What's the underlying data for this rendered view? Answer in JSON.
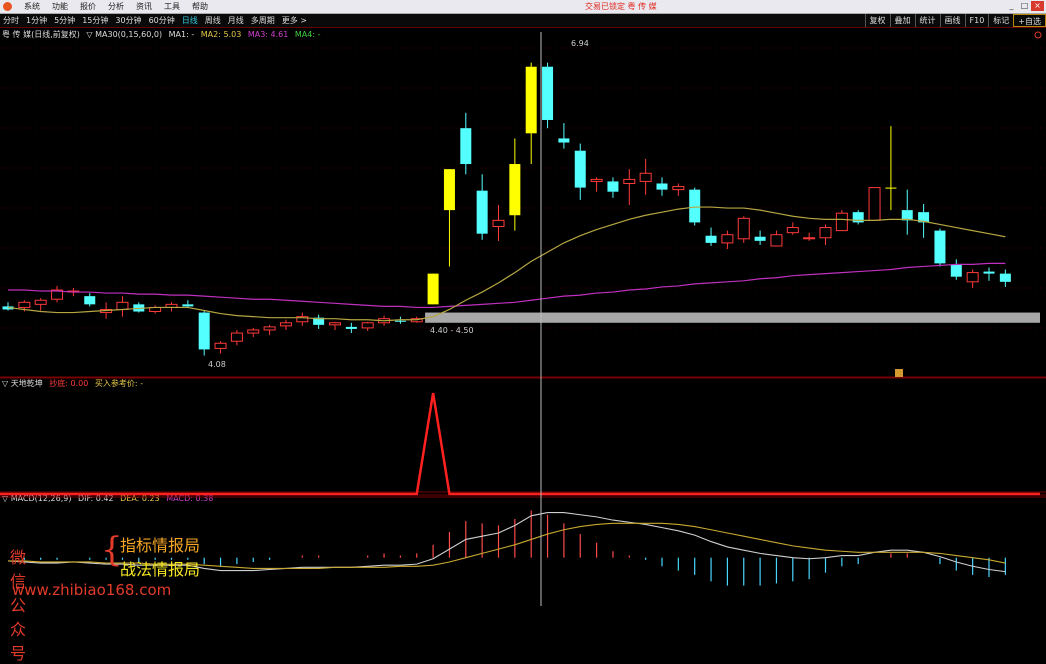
{
  "titlebar": {
    "menu": [
      "系统",
      "功能",
      "报价",
      "分析",
      "资讯",
      "工具",
      "帮助"
    ],
    "window_title": "交易已锁定  粤 传 媒",
    "controls": [
      "_",
      "□",
      "×"
    ]
  },
  "toolbar": {
    "periods": [
      "分时",
      "1分钟",
      "5分钟",
      "15分钟",
      "30分钟",
      "60分钟",
      "日线",
      "周线",
      "月线",
      "多周期",
      "更多 >"
    ],
    "active_period": "日线",
    "right_buttons": [
      "复权",
      "叠加",
      "统计",
      "画线",
      "F10",
      "标记",
      "+自选"
    ]
  },
  "main_legend": {
    "name": "粤 传 媒(日线,前复权)",
    "indicator": "▽ MA30(0,15,60,0)",
    "ma1": "MA1: -",
    "ma2": "MA2: 5.03",
    "ma3": "MA3: 4.61",
    "ma4": "MA4: -"
  },
  "sub1_legend": {
    "name": "▽ 天地乾坤",
    "low": "抄底: 0.00",
    "buy": "买入参考价: -"
  },
  "macd_legend": {
    "name": "▽ MACD(12,26,9)",
    "dif": "DIF: 0.42",
    "dea": "DEA: 0.23",
    "macd": "MACD: 0.38"
  },
  "annotations": {
    "high": "6.94",
    "low": "4.08",
    "band": "4.40 - 4.50"
  },
  "watermark": {
    "left": "微信公众号",
    "line1": "指标情报局",
    "line2": "战法情报局",
    "url": "www.zhibiao168.com"
  },
  "colors": {
    "up": "#ff3a3a",
    "down": "#54ffff",
    "highlight": "#ffff00",
    "ma_short": "#b5a642",
    "ma_long": "#c030c0",
    "band": "#a8a8a8",
    "signal": "#ff2020"
  },
  "chart_data": {
    "type": "candlestick",
    "price_range": [
      3.9,
      7.2
    ],
    "candles": [
      {
        "o": 4.56,
        "h": 4.6,
        "l": 4.52,
        "c": 4.53
      },
      {
        "o": 4.55,
        "h": 4.62,
        "l": 4.51,
        "c": 4.6
      },
      {
        "o": 4.58,
        "h": 4.64,
        "l": 4.52,
        "c": 4.62
      },
      {
        "o": 4.63,
        "h": 4.76,
        "l": 4.6,
        "c": 4.72
      },
      {
        "o": 4.7,
        "h": 4.74,
        "l": 4.66,
        "c": 4.71
      },
      {
        "o": 4.66,
        "h": 4.69,
        "l": 4.56,
        "c": 4.58
      },
      {
        "o": 4.5,
        "h": 4.6,
        "l": 4.44,
        "c": 4.53
      },
      {
        "o": 4.53,
        "h": 4.66,
        "l": 4.46,
        "c": 4.6
      },
      {
        "o": 4.58,
        "h": 4.6,
        "l": 4.5,
        "c": 4.51
      },
      {
        "o": 4.51,
        "h": 4.57,
        "l": 4.49,
        "c": 4.55
      },
      {
        "o": 4.55,
        "h": 4.6,
        "l": 4.51,
        "c": 4.58
      },
      {
        "o": 4.58,
        "h": 4.62,
        "l": 4.55,
        "c": 4.56
      },
      {
        "o": 4.5,
        "h": 4.52,
        "l": 4.08,
        "c": 4.14
      },
      {
        "o": 4.15,
        "h": 4.22,
        "l": 4.1,
        "c": 4.2
      },
      {
        "o": 4.22,
        "h": 4.33,
        "l": 4.18,
        "c": 4.3
      },
      {
        "o": 4.3,
        "h": 4.35,
        "l": 4.26,
        "c": 4.33
      },
      {
        "o": 4.33,
        "h": 4.38,
        "l": 4.28,
        "c": 4.36
      },
      {
        "o": 4.37,
        "h": 4.43,
        "l": 4.33,
        "c": 4.4
      },
      {
        "o": 4.41,
        "h": 4.5,
        "l": 4.37,
        "c": 4.46
      },
      {
        "o": 4.45,
        "h": 4.48,
        "l": 4.34,
        "c": 4.38
      },
      {
        "o": 4.38,
        "h": 4.41,
        "l": 4.33,
        "c": 4.4
      },
      {
        "o": 4.36,
        "h": 4.4,
        "l": 4.3,
        "c": 4.34
      },
      {
        "o": 4.35,
        "h": 4.41,
        "l": 4.32,
        "c": 4.4
      },
      {
        "o": 4.4,
        "h": 4.47,
        "l": 4.37,
        "c": 4.44
      },
      {
        "o": 4.42,
        "h": 4.46,
        "l": 4.39,
        "c": 4.41
      },
      {
        "o": 4.41,
        "h": 4.46,
        "l": 4.4,
        "c": 4.44
      },
      {
        "o": 4.58,
        "h": 4.88,
        "l": 4.58,
        "c": 4.88
      },
      {
        "o": 5.5,
        "h": 5.9,
        "l": 4.95,
        "c": 5.9
      },
      {
        "o": 6.3,
        "h": 6.45,
        "l": 5.85,
        "c": 5.95
      },
      {
        "o": 5.69,
        "h": 5.85,
        "l": 5.21,
        "c": 5.27
      },
      {
        "o": 5.34,
        "h": 5.55,
        "l": 5.2,
        "c": 5.4
      },
      {
        "o": 5.45,
        "h": 6.2,
        "l": 5.3,
        "c": 5.95
      },
      {
        "o": 6.25,
        "h": 6.94,
        "l": 5.95,
        "c": 6.9
      },
      {
        "o": 6.9,
        "h": 6.94,
        "l": 6.3,
        "c": 6.38
      },
      {
        "o": 6.2,
        "h": 6.35,
        "l": 6.1,
        "c": 6.16
      },
      {
        "o": 6.08,
        "h": 6.15,
        "l": 5.6,
        "c": 5.72
      },
      {
        "o": 5.78,
        "h": 5.82,
        "l": 5.68,
        "c": 5.8
      },
      {
        "o": 5.78,
        "h": 5.82,
        "l": 5.62,
        "c": 5.68
      },
      {
        "o": 5.76,
        "h": 5.9,
        "l": 5.55,
        "c": 5.8
      },
      {
        "o": 5.78,
        "h": 6.0,
        "l": 5.65,
        "c": 5.86
      },
      {
        "o": 5.76,
        "h": 5.82,
        "l": 5.64,
        "c": 5.7
      },
      {
        "o": 5.7,
        "h": 5.76,
        "l": 5.64,
        "c": 5.73
      },
      {
        "o": 5.7,
        "h": 5.72,
        "l": 5.35,
        "c": 5.38
      },
      {
        "o": 5.25,
        "h": 5.33,
        "l": 5.15,
        "c": 5.18
      },
      {
        "o": 5.18,
        "h": 5.3,
        "l": 5.12,
        "c": 5.26
      },
      {
        "o": 5.22,
        "h": 5.44,
        "l": 5.18,
        "c": 5.42
      },
      {
        "o": 5.24,
        "h": 5.3,
        "l": 5.16,
        "c": 5.2
      },
      {
        "o": 5.15,
        "h": 5.3,
        "l": 5.15,
        "c": 5.26
      },
      {
        "o": 5.28,
        "h": 5.38,
        "l": 5.26,
        "c": 5.33
      },
      {
        "o": 5.22,
        "h": 5.28,
        "l": 5.2,
        "c": 5.23
      },
      {
        "o": 5.23,
        "h": 5.36,
        "l": 5.16,
        "c": 5.33
      },
      {
        "o": 5.3,
        "h": 5.5,
        "l": 5.3,
        "c": 5.47
      },
      {
        "o": 5.48,
        "h": 5.5,
        "l": 5.36,
        "c": 5.38
      },
      {
        "o": 5.4,
        "h": 5.72,
        "l": 5.4,
        "c": 5.72
      },
      {
        "o": 5.72,
        "h": 6.32,
        "l": 5.5,
        "c": 5.71
      },
      {
        "o": 5.5,
        "h": 5.7,
        "l": 5.26,
        "c": 5.4
      },
      {
        "o": 5.48,
        "h": 5.56,
        "l": 5.23,
        "c": 5.38
      },
      {
        "o": 5.3,
        "h": 5.32,
        "l": 4.95,
        "c": 4.98
      },
      {
        "o": 4.97,
        "h": 5.02,
        "l": 4.82,
        "c": 4.85
      },
      {
        "o": 4.8,
        "h": 4.92,
        "l": 4.74,
        "c": 4.89
      },
      {
        "o": 4.9,
        "h": 4.94,
        "l": 4.81,
        "c": 4.88
      },
      {
        "o": 4.88,
        "h": 4.92,
        "l": 4.75,
        "c": 4.8
      }
    ],
    "highlight_indices": [
      26,
      27,
      31,
      32,
      54
    ],
    "ma_short": [
      4.55,
      4.53,
      4.51,
      4.5,
      4.5,
      4.51,
      4.52,
      4.53,
      4.54,
      4.55,
      4.55,
      4.55,
      4.52,
      4.49,
      4.47,
      4.46,
      4.45,
      4.45,
      4.45,
      4.44,
      4.44,
      4.43,
      4.43,
      4.42,
      4.43,
      4.43,
      4.46,
      4.53,
      4.62,
      4.7,
      4.79,
      4.89,
      5.0,
      5.09,
      5.18,
      5.25,
      5.31,
      5.36,
      5.41,
      5.45,
      5.48,
      5.51,
      5.53,
      5.53,
      5.52,
      5.52,
      5.5,
      5.47,
      5.44,
      5.42,
      5.41,
      5.41,
      5.4,
      5.4,
      5.41,
      5.41,
      5.39,
      5.36,
      5.33,
      5.3,
      5.27,
      5.24
    ],
    "ma_long": [
      4.72,
      4.72,
      4.71,
      4.71,
      4.7,
      4.7,
      4.69,
      4.69,
      4.68,
      4.68,
      4.67,
      4.67,
      4.66,
      4.65,
      4.64,
      4.63,
      4.63,
      4.62,
      4.61,
      4.6,
      4.59,
      4.58,
      4.57,
      4.56,
      4.56,
      4.55,
      4.55,
      4.56,
      4.57,
      4.58,
      4.59,
      4.6,
      4.62,
      4.64,
      4.66,
      4.67,
      4.69,
      4.7,
      4.72,
      4.73,
      4.75,
      4.76,
      4.78,
      4.79,
      4.8,
      4.81,
      4.83,
      4.84,
      4.86,
      4.87,
      4.88,
      4.89,
      4.9,
      4.91,
      4.92,
      4.94,
      4.95,
      4.96,
      4.97,
      4.97,
      4.98,
      4.98
    ],
    "band": [
      4.4,
      4.5
    ],
    "signal": {
      "range": [
        0,
        1.1
      ],
      "values_note": "peak at index 26",
      "peak_index": 26,
      "peak_value": 1.0
    },
    "macd": {
      "range": [
        -0.45,
        0.5
      ],
      "dif": [
        -0.03,
        -0.04,
        -0.05,
        -0.05,
        -0.04,
        -0.05,
        -0.06,
        -0.06,
        -0.07,
        -0.07,
        -0.07,
        -0.07,
        -0.1,
        -0.12,
        -0.12,
        -0.12,
        -0.11,
        -0.1,
        -0.09,
        -0.09,
        -0.09,
        -0.09,
        -0.08,
        -0.07,
        -0.07,
        -0.06,
        -0.01,
        0.08,
        0.17,
        0.2,
        0.23,
        0.3,
        0.39,
        0.42,
        0.42,
        0.4,
        0.38,
        0.35,
        0.33,
        0.31,
        0.28,
        0.25,
        0.21,
        0.15,
        0.1,
        0.07,
        0.04,
        0.02,
        0.0,
        -0.01,
        0.0,
        0.02,
        0.02,
        0.05,
        0.07,
        0.07,
        0.05,
        0.01,
        -0.04,
        -0.08,
        -0.11,
        -0.13
      ],
      "dea": [
        -0.03,
        -0.03,
        -0.04,
        -0.04,
        -0.04,
        -0.04,
        -0.05,
        -0.05,
        -0.05,
        -0.06,
        -0.06,
        -0.06,
        -0.07,
        -0.08,
        -0.09,
        -0.1,
        -0.1,
        -0.1,
        -0.1,
        -0.1,
        -0.09,
        -0.09,
        -0.09,
        -0.09,
        -0.08,
        -0.08,
        -0.07,
        -0.04,
        0.0,
        0.04,
        0.08,
        0.12,
        0.17,
        0.22,
        0.26,
        0.29,
        0.31,
        0.32,
        0.32,
        0.32,
        0.32,
        0.31,
        0.29,
        0.26,
        0.23,
        0.2,
        0.17,
        0.14,
        0.11,
        0.09,
        0.07,
        0.06,
        0.05,
        0.05,
        0.05,
        0.05,
        0.05,
        0.04,
        0.02,
        0.0,
        -0.02,
        -0.05
      ],
      "hist": [
        0.0,
        -0.02,
        -0.02,
        -0.02,
        0.0,
        -0.02,
        -0.02,
        -0.02,
        -0.04,
        -0.02,
        -0.02,
        -0.02,
        -0.06,
        -0.08,
        -0.06,
        -0.04,
        -0.02,
        0.0,
        0.02,
        0.02,
        0.0,
        0.0,
        0.02,
        0.04,
        0.02,
        0.04,
        0.12,
        0.24,
        0.34,
        0.32,
        0.3,
        0.36,
        0.44,
        0.4,
        0.32,
        0.22,
        0.14,
        0.06,
        0.02,
        -0.02,
        -0.08,
        -0.12,
        -0.16,
        -0.22,
        -0.26,
        -0.26,
        -0.26,
        -0.24,
        -0.22,
        -0.2,
        -0.14,
        -0.08,
        -0.06,
        0.0,
        0.04,
        0.04,
        0.0,
        -0.06,
        -0.12,
        -0.16,
        -0.18,
        -0.16
      ]
    }
  }
}
